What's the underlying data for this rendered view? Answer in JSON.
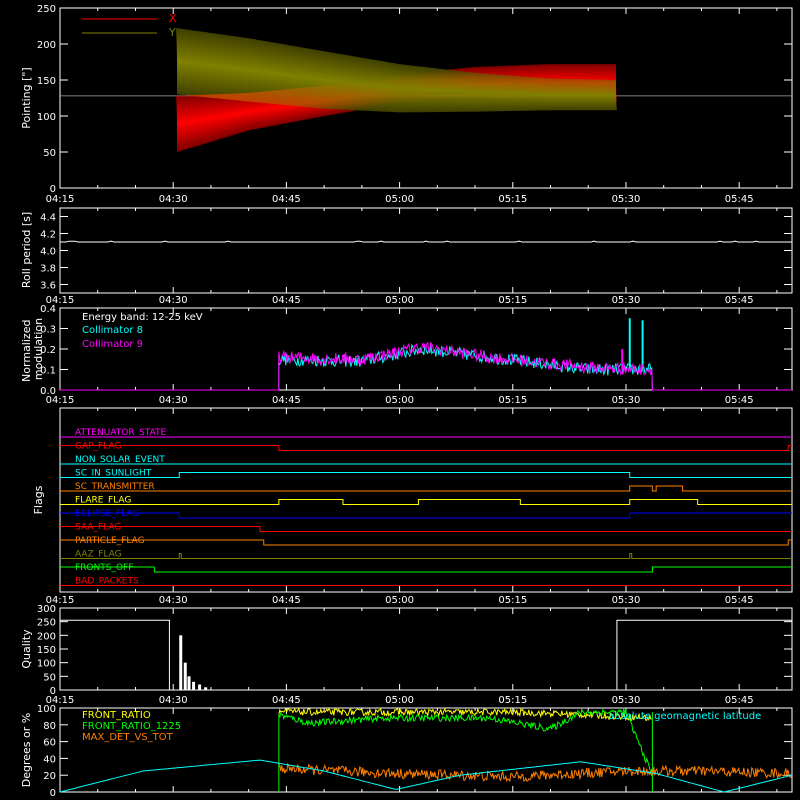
{
  "colors": {
    "background": "#000000",
    "axes": "#ffffff",
    "red": "#ff0000",
    "olive": "#808000",
    "cyan": "#00ffff",
    "magenta": "#ff00ff",
    "yellow": "#ffff00",
    "green": "#00ff00",
    "orange": "#ff8000",
    "blue": "#0000ff",
    "white": "#ffffff"
  },
  "time_axis": {
    "range_minutes": [
      15,
      112
    ],
    "tick_minutes": [
      15,
      30,
      45,
      60,
      75,
      90,
      105
    ],
    "tick_labels": [
      "04:15",
      "04:30",
      "04:45",
      "05:00",
      "05:15",
      "05:30",
      "05:45"
    ]
  },
  "chart_data": [
    {
      "id": "pointing",
      "type": "line",
      "ylabel": "Pointing [\"]",
      "ylim": [
        0,
        250
      ],
      "yticks": [
        0,
        50,
        100,
        150,
        200,
        250
      ],
      "reference_line": 128,
      "legend": {
        "placement": "top-left",
        "entries": [
          "X",
          "Y"
        ]
      },
      "series": [
        {
          "name": "X",
          "color": "#ff0000",
          "start_min": 30.5,
          "end_min": 88.8,
          "envelope": [
            {
              "t": 30.5,
              "low": 50,
              "high": 128
            },
            {
              "t": 40,
              "low": 80,
              "high": 132
            },
            {
              "t": 50,
              "low": 100,
              "high": 142
            },
            {
              "t": 60,
              "low": 118,
              "high": 158
            },
            {
              "t": 70,
              "low": 122,
              "high": 168
            },
            {
              "t": 80,
              "low": 122,
              "high": 172
            },
            {
              "t": 88.8,
              "low": 120,
              "high": 172
            }
          ]
        },
        {
          "name": "Y",
          "color": "#808000",
          "start_min": 30.5,
          "end_min": 88.8,
          "envelope": [
            {
              "t": 30.5,
              "low": 130,
              "high": 222
            },
            {
              "t": 40,
              "low": 120,
              "high": 208
            },
            {
              "t": 50,
              "low": 110,
              "high": 190
            },
            {
              "t": 60,
              "low": 105,
              "high": 172
            },
            {
              "t": 70,
              "low": 106,
              "high": 160
            },
            {
              "t": 80,
              "low": 108,
              "high": 152
            },
            {
              "t": 88.8,
              "low": 108,
              "high": 150
            }
          ]
        }
      ]
    },
    {
      "id": "roll_period",
      "type": "line",
      "ylabel": "Roll period [s]",
      "ylim": [
        3.5,
        4.5
      ],
      "yticks": [
        3.6,
        3.8,
        4.0,
        4.2,
        4.4
      ],
      "ytick_labels": [
        "3.6",
        "3.8",
        "4.0",
        "4.2",
        "4.4"
      ],
      "series": [
        {
          "color": "#ffffff",
          "value": 4.1,
          "start_min": 15,
          "end_min": 112
        }
      ]
    },
    {
      "id": "modulation",
      "type": "line",
      "ylabel_lines": [
        "Normalized",
        "modulation"
      ],
      "ylim": [
        0,
        0.4
      ],
      "yticks": [
        0,
        0.1,
        0.2,
        0.3,
        0.4
      ],
      "ytick_labels": [
        "0.0",
        "0.1",
        "0.2",
        "0.3",
        "0.4"
      ],
      "annotation": "Energy band: 12-25 keV",
      "legend": {
        "placement": "top-left",
        "entries": [
          "Collimator 8",
          "Collimator 9"
        ]
      },
      "active_range_min": [
        44,
        93.5
      ],
      "series": [
        {
          "name": "Collimator 8",
          "color": "#00ffff",
          "levels": [
            {
              "t": 44,
              "v": 0.15
            },
            {
              "t": 55,
              "v": 0.14
            },
            {
              "t": 63,
              "v": 0.2
            },
            {
              "t": 72,
              "v": 0.16
            },
            {
              "t": 85,
              "v": 0.1
            },
            {
              "t": 93,
              "v": 0.1
            }
          ],
          "spikes": [
            {
              "t": 90.5,
              "v": 0.35
            },
            {
              "t": 92.2,
              "v": 0.34
            }
          ]
        },
        {
          "name": "Collimator 9",
          "color": "#ff00ff",
          "levels": [
            {
              "t": 44,
              "v": 0.16
            },
            {
              "t": 55,
              "v": 0.15
            },
            {
              "t": 63,
              "v": 0.21
            },
            {
              "t": 72,
              "v": 0.16
            },
            {
              "t": 85,
              "v": 0.11
            },
            {
              "t": 93,
              "v": 0.1
            }
          ],
          "spikes": [
            {
              "t": 89.5,
              "v": 0.2
            }
          ]
        }
      ]
    },
    {
      "id": "flags",
      "type": "step",
      "ylabel": "Flags",
      "flags": [
        {
          "name": "ATTENUATOR_STATE",
          "color": "#ff00ff",
          "steps": [
            [
              15,
              0
            ],
            [
              112,
              0
            ]
          ]
        },
        {
          "name": "GAP_FLAG",
          "color": "#ff0000",
          "steps": [
            [
              15,
              1
            ],
            [
              44,
              0
            ],
            [
              111.5,
              1
            ]
          ]
        },
        {
          "name": "NON_SOLAR_EVENT",
          "color": "#00ffff",
          "steps": [
            [
              15,
              0
            ]
          ]
        },
        {
          "name": "SC_IN_SUNLIGHT",
          "color": "#00ffff",
          "steps": [
            [
              15,
              0
            ],
            [
              30.8,
              1
            ],
            [
              90.5,
              0
            ]
          ]
        },
        {
          "name": "SC_TRANSMITTER",
          "color": "#ff8000",
          "steps": [
            [
              15,
              0
            ],
            [
              90.5,
              1
            ],
            [
              93.5,
              0
            ],
            [
              94,
              1
            ],
            [
              97.5,
              0
            ]
          ]
        },
        {
          "name": "FLARE_FLAG",
          "color": "#ffff00",
          "steps": [
            [
              15,
              0
            ],
            [
              44,
              1
            ],
            [
              52.5,
              0
            ],
            [
              62.5,
              1
            ],
            [
              76,
              0
            ],
            [
              90.5,
              1
            ],
            [
              99.5,
              0
            ]
          ]
        },
        {
          "name": "ECLIPSE_FLAG",
          "color": "#0000ff",
          "steps": [
            [
              15,
              1
            ],
            [
              30.8,
              0
            ],
            [
              90.5,
              1
            ]
          ]
        },
        {
          "name": "SAA_FLAG",
          "color": "#ff0000",
          "steps": [
            [
              15,
              1
            ],
            [
              41.5,
              0
            ]
          ]
        },
        {
          "name": "PARTICLE_FLAG",
          "color": "#ff8000",
          "steps": [
            [
              15,
              1
            ],
            [
              42,
              0
            ],
            [
              111.5,
              1
            ]
          ]
        },
        {
          "name": "AAZ_FLAG",
          "color": "#808000",
          "pulses": [
            30.8,
            90.5
          ]
        },
        {
          "name": "FRONTS_OFF",
          "color": "#00ff00",
          "steps": [
            [
              15,
              1
            ],
            [
              27.5,
              0
            ],
            [
              93.5,
              1
            ]
          ]
        },
        {
          "name": "BAD_PACKETS",
          "color": "#ff0000",
          "steps": [
            [
              15,
              0
            ]
          ]
        }
      ]
    },
    {
      "id": "quality",
      "type": "bar",
      "ylabel": "Quality",
      "ylim": [
        0,
        300
      ],
      "yticks": [
        0,
        50,
        100,
        150,
        200,
        250,
        300
      ],
      "segments": [
        {
          "start_min": 15,
          "end_min": 29.5,
          "value": 255
        },
        {
          "start_min": 88.8,
          "end_min": 112,
          "value": 255
        }
      ],
      "bars": [
        {
          "t": 31,
          "v": 200
        },
        {
          "t": 31.6,
          "v": 100
        },
        {
          "t": 32.1,
          "v": 50
        },
        {
          "t": 32.7,
          "v": 30
        },
        {
          "t": 33.5,
          "v": 20
        },
        {
          "t": 34.3,
          "v": 10
        }
      ]
    },
    {
      "id": "ratios",
      "type": "line",
      "ylabel": "Degrees or %",
      "ylim": [
        0,
        100
      ],
      "yticks": [
        0,
        20,
        40,
        60,
        80,
        100
      ],
      "legend": {
        "placement": "top-left",
        "entries": [
          "FRONT_RATIO",
          "FRONT_RATIO_1225",
          "MAX_DET_VS_TOT"
        ]
      },
      "annotation": "absolute geomagnetic latitude",
      "series": [
        {
          "name": "FRONT_RATIO",
          "color": "#ffff00",
          "points": [
            {
              "t": 44,
              "v": 96
            },
            {
              "t": 48,
              "v": 95
            },
            {
              "t": 60,
              "v": 95
            },
            {
              "t": 75,
              "v": 95
            },
            {
              "t": 85,
              "v": 92
            },
            {
              "t": 93.5,
              "v": 88
            }
          ]
        },
        {
          "name": "FRONT_RATIO_1225",
          "color": "#00ff00",
          "points": [
            {
              "t": 44,
              "v": 92
            },
            {
              "t": 48,
              "v": 82
            },
            {
              "t": 58,
              "v": 88
            },
            {
              "t": 72,
              "v": 88
            },
            {
              "t": 80,
              "v": 75
            },
            {
              "t": 84,
              "v": 95
            },
            {
              "t": 90,
              "v": 95
            },
            {
              "t": 93.5,
              "v": 20
            }
          ],
          "edges": [
            {
              "t": 44,
              "from": 0,
              "to": 92
            },
            {
              "t": 93.5,
              "from": 95,
              "to": 0
            }
          ]
        },
        {
          "name": "MAX_DET_VS_TOT",
          "color": "#ff8000",
          "points": [
            {
              "t": 44,
              "v": 28
            },
            {
              "t": 60,
              "v": 22
            },
            {
              "t": 75,
              "v": 18
            },
            {
              "t": 90,
              "v": 25
            },
            {
              "t": 100,
              "v": 25
            },
            {
              "t": 112,
              "v": 22
            }
          ]
        },
        {
          "name": "absolute geomagnetic latitude",
          "color": "#00ffff",
          "points": [
            {
              "t": 15,
              "v": 0
            },
            {
              "t": 26,
              "v": 25
            },
            {
              "t": 41.5,
              "v": 38
            },
            {
              "t": 50,
              "v": 25
            },
            {
              "t": 59.5,
              "v": 3
            },
            {
              "t": 68,
              "v": 20
            },
            {
              "t": 84,
              "v": 36
            },
            {
              "t": 94,
              "v": 22
            },
            {
              "t": 103,
              "v": 0
            },
            {
              "t": 112,
              "v": 20
            }
          ]
        }
      ]
    }
  ]
}
